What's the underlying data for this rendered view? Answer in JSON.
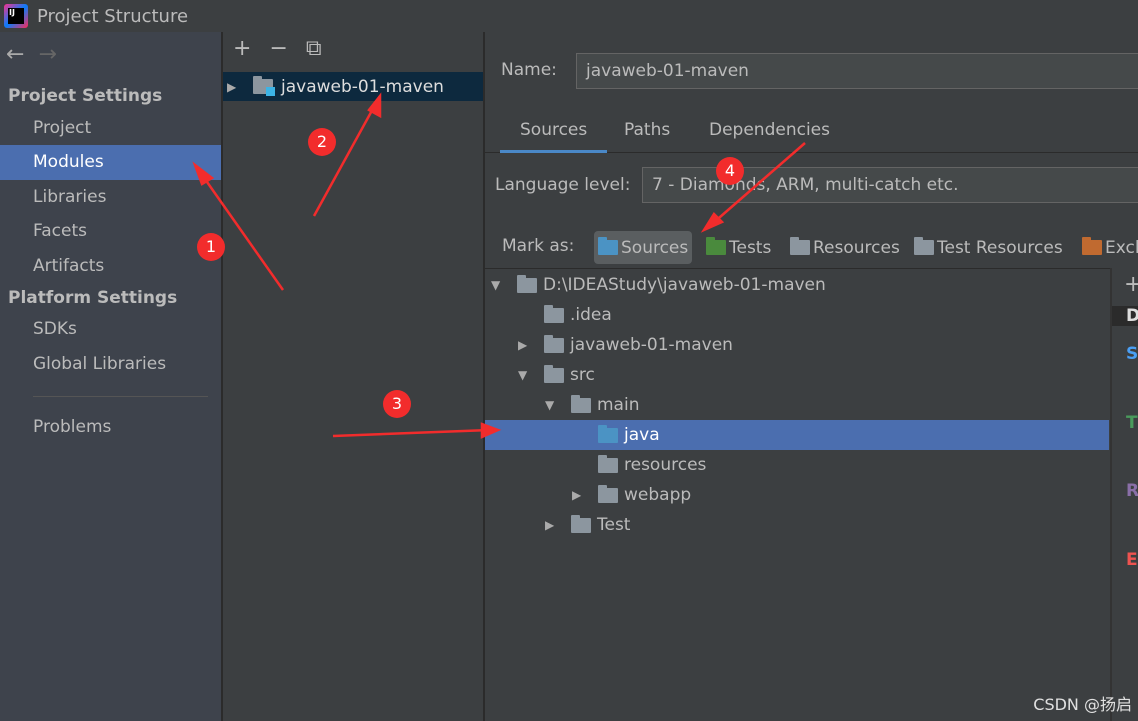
{
  "window": {
    "title": "Project Structure",
    "logo_text": "IJ"
  },
  "nav": {
    "back": "←",
    "forward": "→"
  },
  "sidebar": {
    "project_settings": "Project Settings",
    "items": [
      {
        "label": "Project"
      },
      {
        "label": "Modules",
        "selected": true
      },
      {
        "label": "Libraries"
      },
      {
        "label": "Facets"
      },
      {
        "label": "Artifacts"
      }
    ],
    "platform_settings": "Platform Settings",
    "platform_items": [
      {
        "label": "SDKs"
      },
      {
        "label": "Global Libraries"
      }
    ],
    "problems": "Problems"
  },
  "modules": {
    "add": "+",
    "remove": "−",
    "copy": "⧉",
    "items": [
      {
        "label": "javaweb-01-maven",
        "selected": true
      }
    ]
  },
  "editor": {
    "name_label": "Name:",
    "name_value": "javaweb-01-maven",
    "tabs": [
      {
        "label": "Sources",
        "selected": true
      },
      {
        "label": "Paths"
      },
      {
        "label": "Dependencies"
      }
    ],
    "language_label": "Language level:",
    "language_value": "7 - Diamonds, ARM, multi-catch etc.",
    "mark_as_label": "Mark as:",
    "mark_as": [
      {
        "label": "Sources",
        "color": "#4b93c4"
      },
      {
        "label": "Tests",
        "color": "#4a8a3d"
      },
      {
        "label": "Resources",
        "color": "#8c969f"
      },
      {
        "label": "Test Resources",
        "color": "#8c969f"
      },
      {
        "label": "Excl",
        "color": "#c06a30"
      }
    ],
    "tree": [
      {
        "label": "D:\\IDEAStudy\\javaweb-01-maven",
        "depth": 0,
        "arrow": "▼"
      },
      {
        "label": ".idea",
        "depth": 1,
        "arrow": ""
      },
      {
        "label": "javaweb-01-maven",
        "depth": 1,
        "arrow": "▶"
      },
      {
        "label": "src",
        "depth": 1,
        "arrow": "▼"
      },
      {
        "label": "main",
        "depth": 2,
        "arrow": "▼"
      },
      {
        "label": "java",
        "depth": 3,
        "arrow": "",
        "selected": true,
        "color": "#4b93c4"
      },
      {
        "label": "resources",
        "depth": 3,
        "arrow": ""
      },
      {
        "label": "webapp",
        "depth": 3,
        "arrow": "▶"
      },
      {
        "label": "Test",
        "depth": 2,
        "arrow": "▶"
      }
    ],
    "roots_panel": {
      "add": "+",
      "header": "D",
      "sources": "S",
      "tests": "T",
      "resources": "R",
      "excluded": "E"
    }
  },
  "annotations": [
    "1",
    "2",
    "3",
    "4"
  ],
  "watermark": "CSDN @扬启",
  "colors": {
    "selection": "#4b6eaf",
    "annotation": "#f22c2c"
  }
}
